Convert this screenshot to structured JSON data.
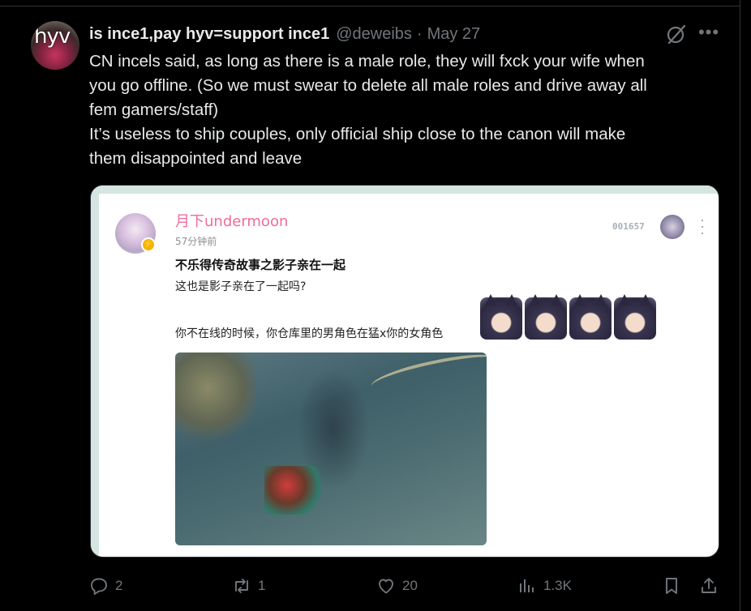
{
  "tweet": {
    "avatar_text": "hyv",
    "display_name": "is ince1,pay hyv=support ince1",
    "handle": "@deweibs",
    "separator": "·",
    "date": "May 27",
    "text_lines": [
      "CN incels said, as long as there is a male role, they will fxck your wife when",
      "you go offline. (So we must swear to delete all male roles and drive away all",
      "fem gamers/staff)",
      "It’s useless to ship couples, only official ship close to the canon will make",
      "them disappointed and leave"
    ]
  },
  "embedded_screenshot": {
    "username": "月下undermoon",
    "time_ago": "57分钟前",
    "title": "不乐得传奇故事之影子亲在一起",
    "line1": "这也是影子亲在了一起吗?",
    "line2": "你不在线的时候，你仓库里的男角色在猛x你的女角色",
    "code": "001657",
    "sticker_count": 4
  },
  "actions": {
    "reply_count": "2",
    "retweet_count": "1",
    "like_count": "20",
    "views_count": "1.3K"
  },
  "colors": {
    "background": "#000000",
    "text_primary": "#e7e9ea",
    "text_secondary": "#71767b",
    "username_pink": "#f06b9c"
  }
}
